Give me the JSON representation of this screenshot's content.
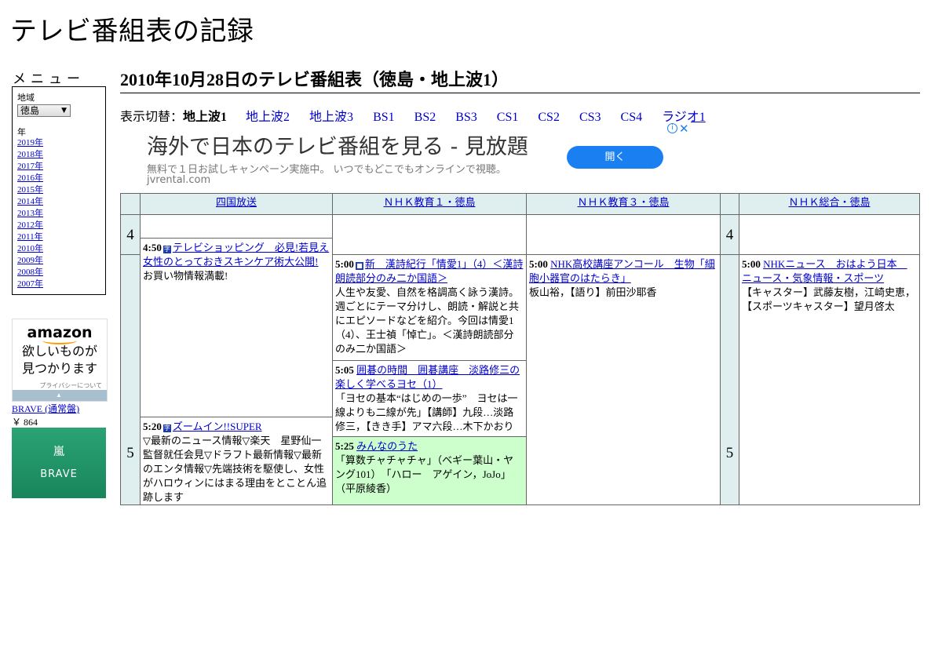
{
  "site_title": "テレビ番組表の記録",
  "menu": {
    "title": "メニュー",
    "region_label": "地域",
    "region_value": "徳島",
    "year_label": "年",
    "years": [
      "2019年",
      "2018年",
      "2017年",
      "2016年",
      "2015年",
      "2014年",
      "2013年",
      "2012年",
      "2011年",
      "2010年",
      "2009年",
      "2008年",
      "2007年"
    ]
  },
  "amazon_ad": {
    "logo": "amazon",
    "text_line1": "欲しいものが",
    "text_line2": "見つかります",
    "privacy": "プライバシーについて"
  },
  "product": {
    "name": "BRAVE (通常盤)",
    "price": "￥ 864",
    "card_line1": "嵐",
    "card_line2": "BRAVE"
  },
  "page_heading": "2010年10月28日のテレビ番組表（徳島・地上波1）",
  "switcher": {
    "label": "表示切替：",
    "current": "地上波1",
    "links": [
      "地上波2",
      "地上波3",
      "BS1",
      "BS2",
      "BS3",
      "CS1",
      "CS2",
      "CS3",
      "CS4",
      "ラジオ1"
    ]
  },
  "ad_banner": {
    "title": "海外で日本のテレビ番組を見る - 見放題",
    "desc": "無料で１日お試しキャンペーン実施中。 いつでもどこでもオンラインで視聴。",
    "url": "jvrental.com",
    "button": "開く",
    "info_icon": "i",
    "close_icon": "✕"
  },
  "channels": [
    "四国放送",
    "ＮＨＫ教育１・徳島",
    "ＮＨＫ教育３・徳島",
    "ＮＨＫ総合・徳島"
  ],
  "hours": [
    "4",
    "5"
  ],
  "programs": {
    "c1p1": {
      "time": "4:50",
      "icon": "字",
      "title": "テレビショッピング　必見!若見え女性のとっておきスキンケア術大公開!",
      "desc": "お買い物情報満載!"
    },
    "c1p2": {
      "time": "5:20",
      "icon": "字",
      "title": "ズームイン!!SUPER",
      "desc": "▽最新のニュース情報▽楽天　星野仙一監督就任会見▽ドラフト最新情報▽最新のエンタ情報▽先端技術を駆使し、女性がハロウィンにはまる理由をとことん追跡します"
    },
    "c2p1": {
      "time": "5:00",
      "icon": "■",
      "title": "新　漢詩紀行「情愛1」（4）＜漢詩朗読部分のみ二か国語＞",
      "desc": "人生や友愛、自然を格調高く詠う漢詩。週ごとにテーマ分けし、朗読・解説と共にエピソードなどを紹介。今回は情愛1（4）、王士禎「悼亡」。＜漢詩朗読部分のみ二か国語＞"
    },
    "c2p2": {
      "time": "5:05",
      "title": "囲碁の時間　囲碁講座　淡路修三の楽しく学べるヨセ（1）",
      "desc": "「ヨセの基本“はじめの一歩”　ヨセは一線よりも二線が先」【講師】九段…淡路修三，【きき手】アマ六段…木下かおり"
    },
    "c2p3": {
      "time": "5:25",
      "title": "みんなのうた",
      "desc": "「算数チャチャチャ」（ベギー葉山・ヤング101）　「ハロー　アゲイン，JoJo」（平原綾香）"
    },
    "c3p1": {
      "time": "5:00",
      "title": "NHK高校講座アンコール　生物「細胞小器官のはたらき」",
      "desc": "板山裕，【語り】前田沙耶香"
    },
    "c4p1": {
      "time": "5:00",
      "title": "NHKニュース　おはよう日本　ニュース・気象情報・スポーツ",
      "desc": "【キャスター】武藤友樹，江崎史恵，【スポーツキャスター】望月啓太"
    }
  }
}
